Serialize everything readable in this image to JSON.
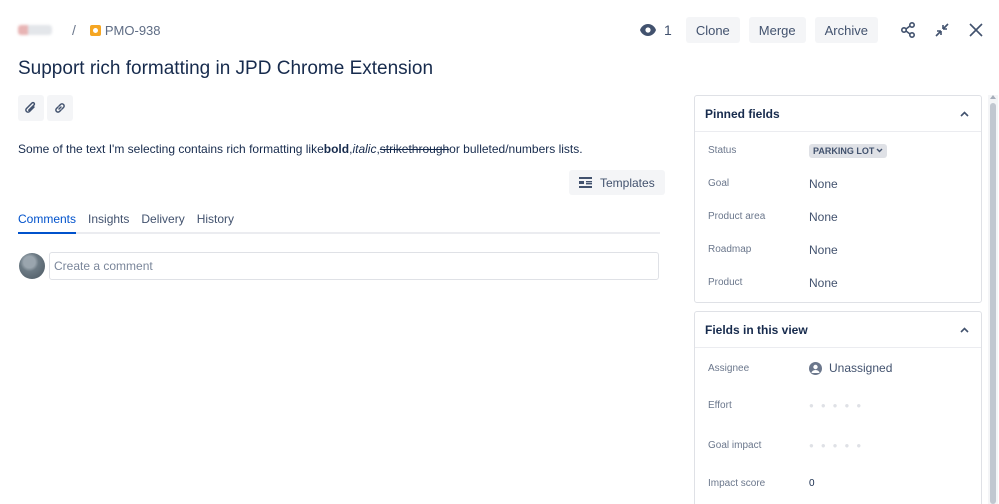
{
  "breadcrumb": {
    "project": "",
    "separator": "/",
    "issue_key": "PMO-938"
  },
  "toolbar": {
    "watch_count": "1",
    "clone_label": "Clone",
    "merge_label": "Merge",
    "archive_label": "Archive",
    "icons": [
      "eye-icon",
      "share-icon",
      "minimize-icon",
      "close-icon"
    ]
  },
  "issue": {
    "title": "Support rich formatting in JPD Chrome Extension",
    "description": {
      "prefix": "Some of the text I'm selecting contains rich formatting like",
      "bold": "bold",
      "comma1": ",",
      "italic": "italic",
      "comma2": ",",
      "strike": "strikethrough",
      "suffix": "or bulleted/numbers lists."
    },
    "templates_label": "Templates"
  },
  "tabs": [
    {
      "label": "Comments",
      "active": true
    },
    {
      "label": "Insights",
      "active": false
    },
    {
      "label": "Delivery",
      "active": false
    },
    {
      "label": "History",
      "active": false
    }
  ],
  "comment": {
    "placeholder": "Create a comment"
  },
  "pinned_fields": {
    "title": "Pinned fields",
    "rows": [
      {
        "label": "Status",
        "value": "PARKING LOT"
      },
      {
        "label": "Goal",
        "value": "None"
      },
      {
        "label": "Product area",
        "value": "None"
      },
      {
        "label": "Roadmap",
        "value": "None"
      },
      {
        "label": "Product",
        "value": "None"
      }
    ]
  },
  "view_fields": {
    "title": "Fields in this view",
    "rows": [
      {
        "label": "Assignee",
        "value": "Unassigned"
      },
      {
        "label": "Effort",
        "value": "",
        "rating": 0
      },
      {
        "label": "Goal impact",
        "value": "",
        "rating": 0
      },
      {
        "label": "Impact score",
        "value": "0"
      }
    ]
  },
  "colors": {
    "accent": "#0052cc",
    "text": "#172b4d",
    "subtle": "#6b778c",
    "button_bg": "#f4f5f7"
  }
}
